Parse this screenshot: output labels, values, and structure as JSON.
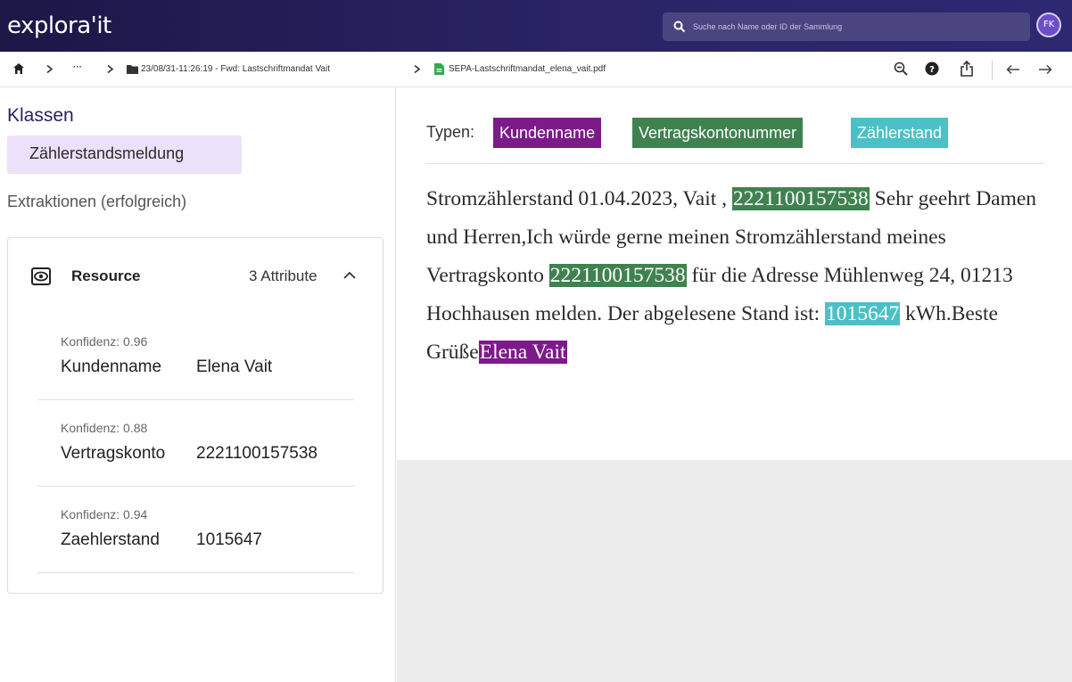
{
  "app": {
    "logo": "explora'it",
    "avatar_initials": "FK"
  },
  "search": {
    "placeholder": "Suche nach Name oder ID der Sammlung"
  },
  "breadcrumb": {
    "ellipsis": "···",
    "folder": "23/08/31-11:26:19 - Fwd: Lastschriftmandat Vait",
    "file": "SEPA-Lastschriftmandat_elena_vait.pdf"
  },
  "toolbar": {
    "icons": [
      "zoom-out-icon",
      "help-icon",
      "share-icon",
      "arrow-left-icon",
      "arrow-right-icon"
    ]
  },
  "sidebar": {
    "klassen_title": "Klassen",
    "class_chip": "Zählerstandsmeldung",
    "extraktionen_title": "Extraktionen (erfolgreich)",
    "card": {
      "title": "Resource",
      "count_label": "3 Attribute",
      "items": [
        {
          "confidence": "Konfidenz: 0.96",
          "key": "Kundenname",
          "value": "Elena Vait"
        },
        {
          "confidence": "Konfidenz: 0.88",
          "key": "Vertragskonto",
          "value": "2221100157538"
        },
        {
          "confidence": "Konfidenz: 0.94",
          "key": "Zaehlerstand",
          "value": "1015647"
        }
      ]
    }
  },
  "document": {
    "types_label": "Typen:",
    "types": [
      "Kundenname",
      "Vertragskontonummer",
      "Zählerstand"
    ],
    "colors": {
      "kundenname": "#7d1a8a",
      "vertragskonto": "#3f8250",
      "zaehlerstand": "#4cc0c7"
    },
    "text": {
      "p1": "Stromzählerstand 01.04.2023, Vait , ",
      "hl1": "2221100157538",
      "p2": " Sehr geehrt Damen und Herren,Ich würde gerne meinen Stromzählerstand meines Vertragskonto ",
      "hl2": "2221100157538",
      "p3": " für die Adresse Mühlenweg 24, 01213 Hochhausen melden. Der abgelesene Stand ist: ",
      "hl3": "1015647",
      "p4": " kWh.Beste Grüße",
      "hl4": "Elena Vait"
    }
  }
}
